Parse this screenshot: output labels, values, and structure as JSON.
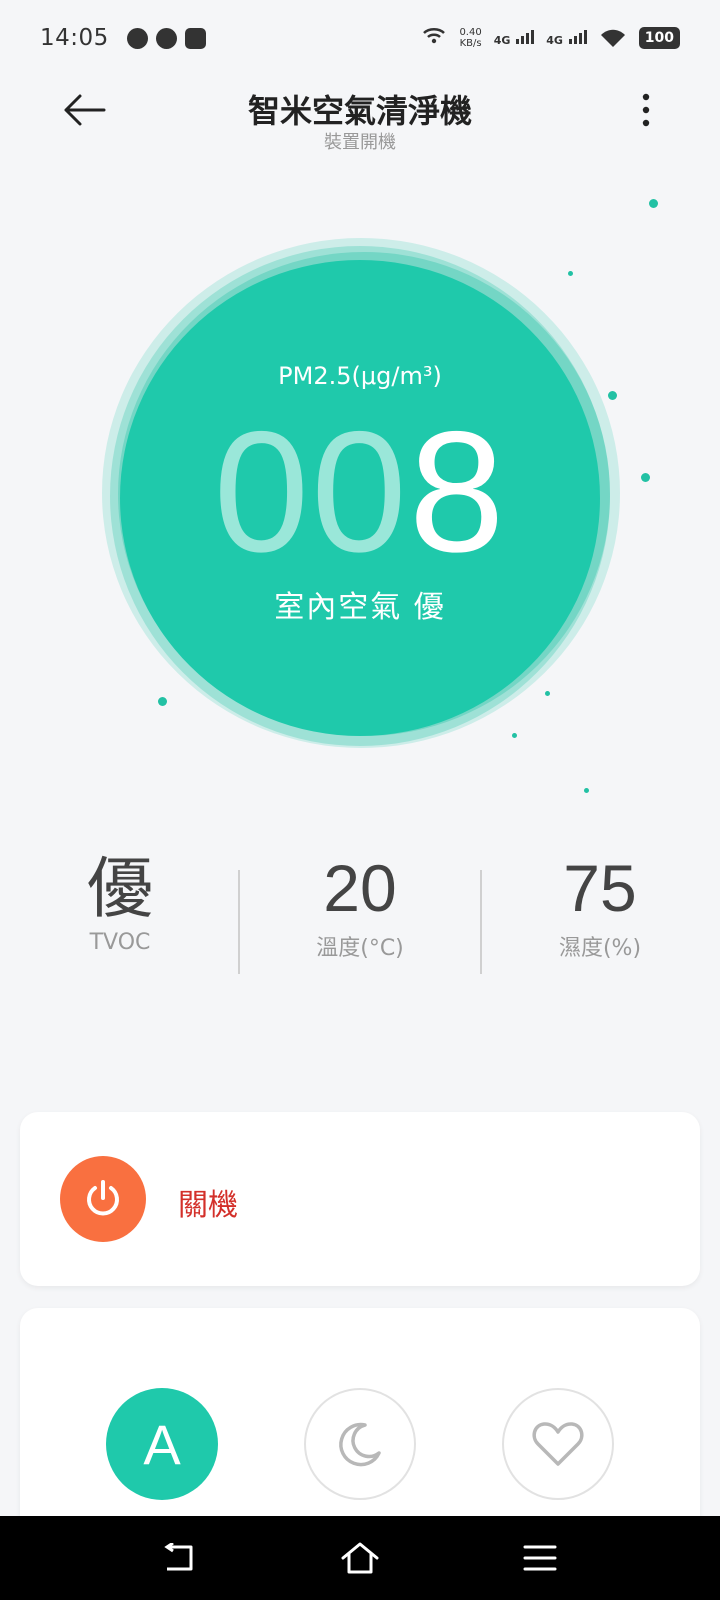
{
  "status_bar": {
    "time": "14:05",
    "speed_value": "0.40",
    "speed_unit": "KB/s",
    "network_1": "4G",
    "network_2": "4G",
    "battery": "100"
  },
  "header": {
    "title": "智米空氣清淨機",
    "subtitle": "裝置開機"
  },
  "air_quality": {
    "pm_label": "PM2.5(μg/m³)",
    "pm_value_leading": "00",
    "pm_value_significant": "8",
    "quality_label": "室內空氣 優"
  },
  "stats": [
    {
      "value": "優",
      "label": "TVOC"
    },
    {
      "value": "20",
      "label": "溫度(°C)"
    },
    {
      "value": "75",
      "label": "濕度(%)"
    }
  ],
  "power": {
    "label": "關機"
  },
  "modes": {
    "auto_label": "A"
  },
  "colors": {
    "accent": "#1fc9ab",
    "power": "#f97040",
    "power_text": "#d3302a"
  }
}
